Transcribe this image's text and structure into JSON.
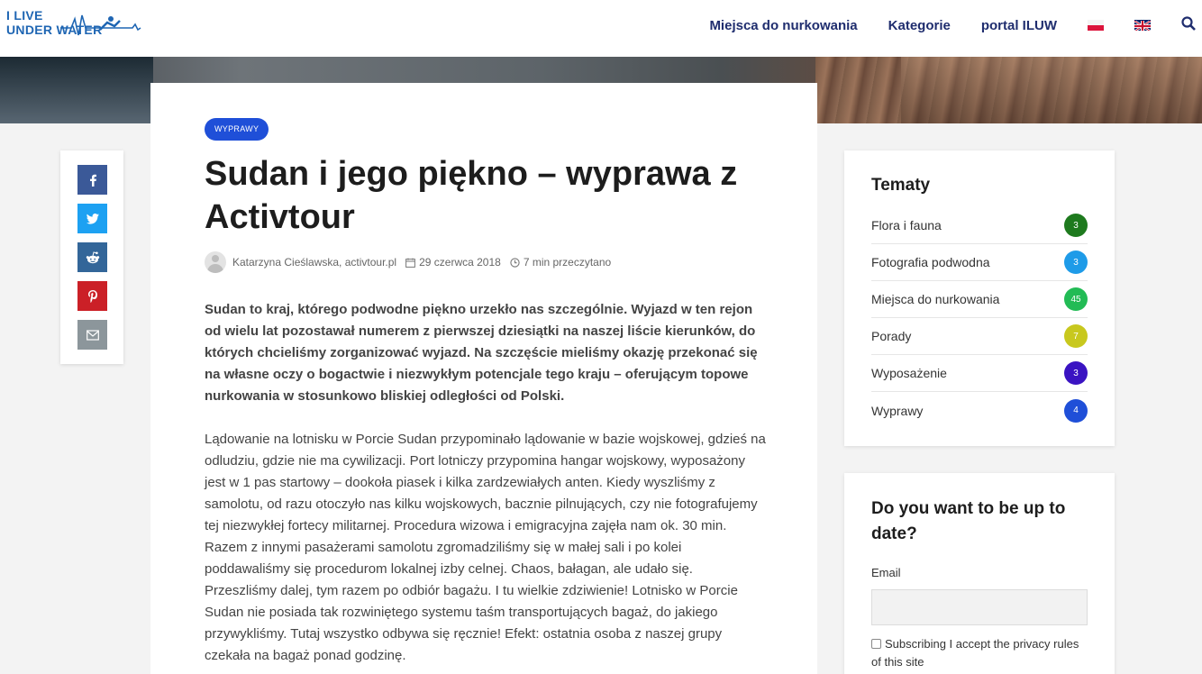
{
  "header": {
    "logo_line1": "I LIVE",
    "logo_line2": "UNDER WATER",
    "nav": [
      "Miejsca do nurkowania",
      "Kategorie",
      "portal ILUW"
    ],
    "flags": [
      "pl-flag",
      "uk-flag"
    ],
    "search_icon": "search-icon"
  },
  "share": {
    "icons": [
      "facebook-icon",
      "twitter-icon",
      "reddit-icon",
      "pinterest-icon",
      "email-icon"
    ],
    "colors": {
      "facebook": "#3b5998",
      "twitter": "#1da1f2",
      "reddit": "#336699",
      "pinterest": "#cb2027",
      "email": "#8c969b"
    }
  },
  "article": {
    "badge": "WYPRAWY",
    "title": "Sudan i jego piękno – wyprawa z Activtour",
    "author": "Katarzyna Cieślawska, activtour.pl",
    "date": "29 czerwca 2018",
    "read_time": "7 min przeczytano",
    "lead": "Sudan to kraj, którego podwodne piękno urzekło nas szczególnie. Wyjazd w ten rejon od wielu lat pozostawał numerem z pierwszej dziesiątki na naszej liście kierunków, do których chcieliśmy zorganizować wyjazd. Na szczęście mieliśmy okazję przekonać się na własne oczy o bogactwie i niezwykłym potencjale tego kraju – oferującym topowe nurkowania w stosunkowo bliskiej odległości od Polski.",
    "paragraph": "Lądowanie na lotnisku w Porcie Sudan przypominało lądowanie w bazie wojskowej, gdzieś na odludziu, gdzie nie ma cywilizacji. Port lotniczy przypomina hangar wojskowy, wyposażony jest w 1 pas startowy – dookoła piasek i kilka zardzewiałych anten. Kiedy wyszliśmy z samolotu, od razu otoczyło nas kilku wojskowych, bacznie pilnujących, czy nie fotografujemy tej niezwykłej fortecy militarnej. Procedura wizowa i emigracyjna zajęła nam ok. 30 min. Razem z innymi pasażerami samolotu zgromadziliśmy się w małej sali i po kolei poddawaliśmy się procedurom lokalnej izby celnej. Chaos, bałagan, ale udało się. Przeszliśmy dalej, tym razem po odbiór bagażu. I tu wielkie zdziwienie! Lotnisko w Porcie Sudan nie posiada tak rozwiniętego systemu taśm transportujących bagaż, do jakiego przywykliśmy. Tutaj wszystko odbywa się ręcznie! Efekt: ostatnia osoba z naszej grupy czekała na bagaż ponad godzinę."
  },
  "sidebar": {
    "topics_title": "Tematy",
    "topics": [
      {
        "name": "Flora i fauna",
        "count": "3",
        "color": "#1e7a1e"
      },
      {
        "name": "Fotografia podwodna",
        "count": "3",
        "color": "#1e9be8"
      },
      {
        "name": "Miejsca do nurkowania",
        "count": "45",
        "color": "#22bb55"
      },
      {
        "name": "Porady",
        "count": "7",
        "color": "#c8c81e"
      },
      {
        "name": "Wyposażenie",
        "count": "3",
        "color": "#3a13c2"
      },
      {
        "name": "Wyprawy",
        "count": "4",
        "color": "#1f4fd8"
      }
    ],
    "newsletter_title": "Do you want to be up to date?",
    "email_label": "Email",
    "email_value": "",
    "consent_text": "Subscribing I accept the privacy rules of this site"
  }
}
